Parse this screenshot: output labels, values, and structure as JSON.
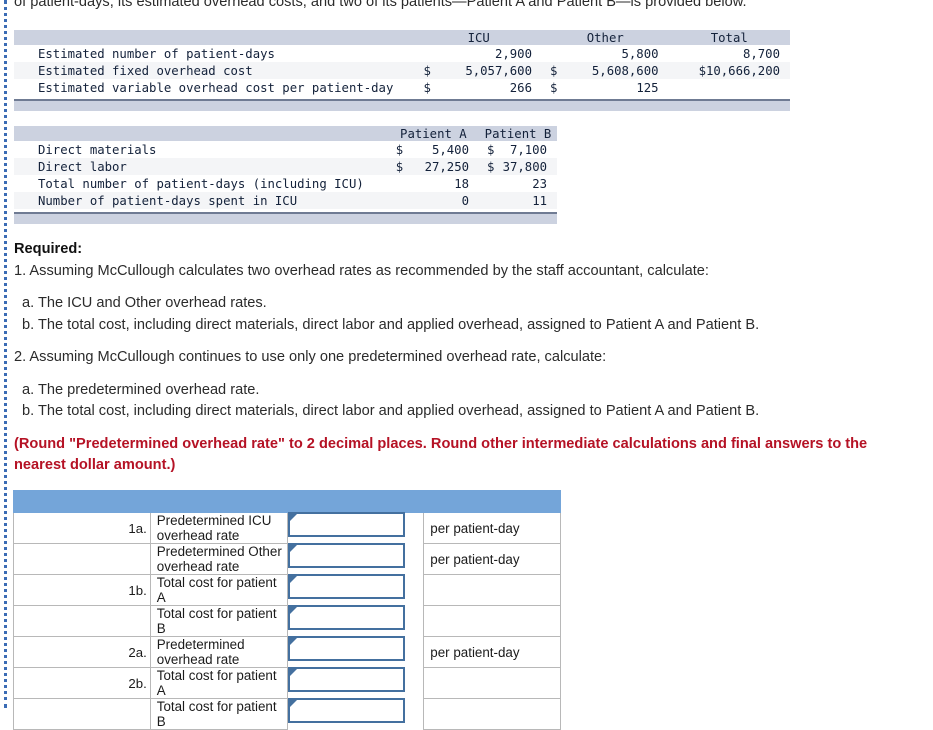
{
  "intro": {
    "text": "of patient-days, its estimated overhead costs, and two of its patients—Patient A and Patient B—is provided below."
  },
  "colors": {
    "exhibit_header_bg": "#ccd2e0",
    "answer_header_bg": "#74a5d9",
    "input_border": "#44709f",
    "note_red": "#b51225",
    "rail_blue": "#3b6cb5"
  },
  "exhibit_one": {
    "headers": [
      "",
      "ICU",
      "Other",
      "Total"
    ],
    "rows": [
      {
        "label": "Estimated number of patient-days",
        "icu_currency": "",
        "icu_value": "2,900",
        "other_currency": "",
        "other_value": "5,800",
        "total_currency": "",
        "total_value": "8,700"
      },
      {
        "label": "Estimated fixed overhead cost",
        "icu_currency": "$",
        "icu_value": "5,057,600",
        "other_currency": "$",
        "other_value": "5,608,600",
        "total_currency": "",
        "total_value": "$10,666,200"
      },
      {
        "label": "Estimated variable overhead cost per patient-day",
        "icu_currency": "$",
        "icu_value": "266",
        "other_currency": "$",
        "other_value": "125",
        "total_currency": "",
        "total_value": ""
      }
    ]
  },
  "exhibit_two": {
    "headers": [
      "",
      "Patient A",
      "Patient B"
    ],
    "rows": [
      {
        "label": "Direct materials",
        "a_currency": "$",
        "a_value": "5,400",
        "b_currency": "$",
        "b_value": "7,100"
      },
      {
        "label": "Direct labor",
        "a_currency": "$",
        "a_value": "27,250",
        "b_currency": "$",
        "b_value": "37,800"
      },
      {
        "label": "Total number of patient-days (including ICU)",
        "a_currency": "",
        "a_value": "18",
        "b_currency": "",
        "b_value": "23"
      },
      {
        "label": "Number of patient-days spent in ICU",
        "a_currency": "",
        "a_value": "0",
        "b_currency": "",
        "b_value": "11"
      }
    ]
  },
  "required": {
    "heading": "Required:",
    "item1": "1. Assuming McCullough calculates two overhead rates as recommended by the staff accountant, calculate:",
    "item1a": "a. The ICU and Other overhead rates.",
    "item1b": "b. The total cost, including direct materials, direct labor and applied overhead, assigned to Patient A and Patient B.",
    "item2": "2. Assuming McCullough continues to use only one predetermined overhead rate, calculate:",
    "item2a": "a. The predetermined overhead rate.",
    "item2b": "b. The total cost, including direct materials, direct labor and applied overhead, assigned to Patient A and Patient B.",
    "note_line1": "(Round \"Predetermined overhead rate\" to 2 decimal places. Round other intermediate calculations and final answers to the",
    "note_line2": "nearest dollar amount.)"
  },
  "answer_table": {
    "header_label": "",
    "rows": [
      {
        "index": "1a.",
        "description": "Predetermined ICU overhead rate",
        "value": "",
        "unit": "per patient-day"
      },
      {
        "index": "",
        "description": "Predetermined Other overhead rate",
        "value": "",
        "unit": "per patient-day"
      },
      {
        "index": "1b.",
        "description": "Total cost for patient A",
        "value": "",
        "unit": ""
      },
      {
        "index": "",
        "description": "Total cost for patient B",
        "value": "",
        "unit": ""
      },
      {
        "index": "2a.",
        "description": "Predetermined overhead rate",
        "value": "",
        "unit": "per patient-day"
      },
      {
        "index": "2b.",
        "description": "Total cost for patient A",
        "value": "",
        "unit": ""
      },
      {
        "index": "",
        "description": "Total cost for patient B",
        "value": "",
        "unit": ""
      }
    ]
  }
}
